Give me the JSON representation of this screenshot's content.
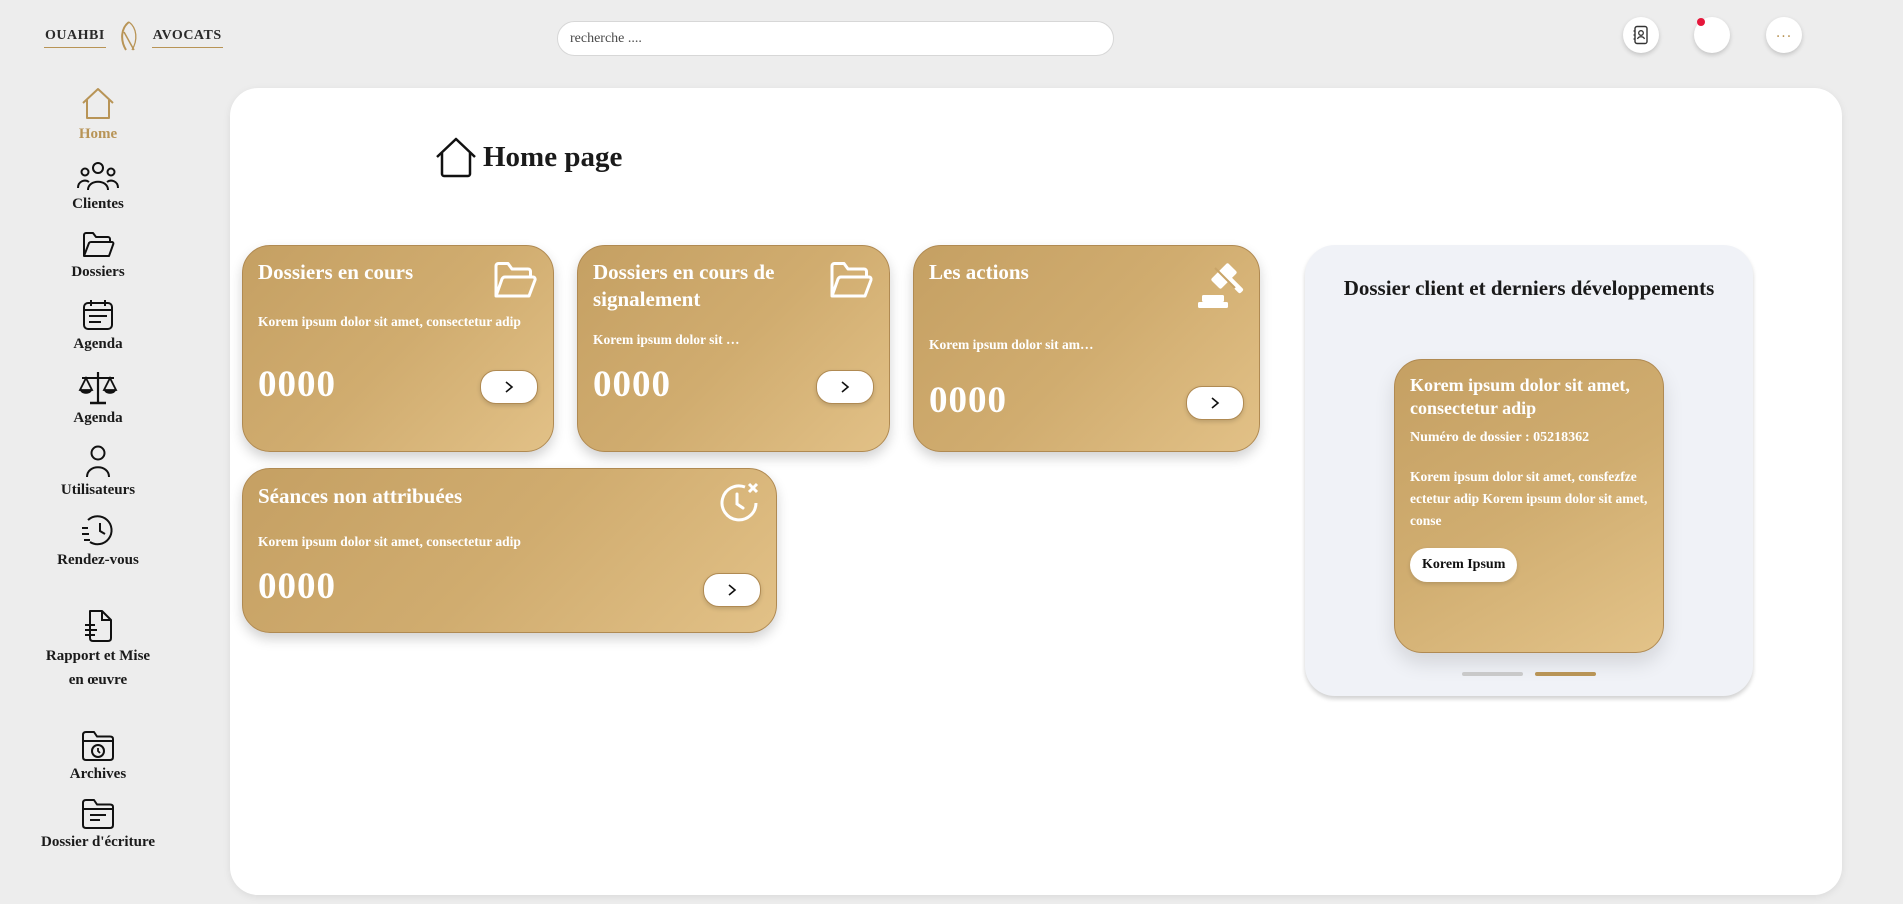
{
  "brand": {
    "left_word": "OUAHBI",
    "right_word": "AVOCATS"
  },
  "search": {
    "placeholder": "recherche ...."
  },
  "topbar": {
    "icons": [
      "contacts-icon",
      "notification-icon",
      "more-icon"
    ],
    "more_label": "..."
  },
  "sidebar": {
    "items": [
      {
        "label": "Home",
        "icon": "home-icon",
        "active": true
      },
      {
        "label": "Clientes",
        "icon": "users-icon"
      },
      {
        "label": "Dossiers",
        "icon": "folder-icon"
      },
      {
        "label": "Agenda",
        "icon": "calendar-icon"
      },
      {
        "label": "Agenda",
        "icon": "scales-icon"
      },
      {
        "label": "Utilisateurs",
        "icon": "user-icon"
      },
      {
        "label": "Rendez-vous",
        "icon": "clock-list-icon"
      },
      {
        "label": "Rapport et Mise en œuvre",
        "icon": "report-icon"
      },
      {
        "label": "Archives",
        "icon": "archive-icon"
      },
      {
        "label": "Dossier d'écriture",
        "icon": "writing-folder-icon"
      }
    ]
  },
  "page": {
    "title": "Home page",
    "icon": "home-icon"
  },
  "cards": [
    {
      "title": "Dossiers en cours",
      "text": "Korem ipsum dolor sit amet, consectetur adip",
      "value": "0000",
      "icon": "folder-icon"
    },
    {
      "title": "Dossiers en cours de signalement",
      "text": "Korem ipsum dolor sit …",
      "value": "0000",
      "icon": "folder-icon"
    },
    {
      "title": "Les actions",
      "text": "Korem ipsum dolor sit am…",
      "value": "0000",
      "icon": "gavel-icon"
    },
    {
      "title": "Séances non attribuées",
      "text": "Korem ipsum dolor sit amet, consectetur adip",
      "value": "0000",
      "icon": "clock-cancel-icon"
    }
  ],
  "widget": {
    "title": "Dossier client et derniers développements",
    "card": {
      "title": "Korem ipsum dolor sit amet, consectetur adip",
      "file_number": "Numéro de dossier : 05218362",
      "description": "Korem ipsum dolor sit amet, consfezfze ectetur adip Korem ipsum dolor sit amet, conse",
      "button": "Korem Ipsum"
    },
    "carousel": {
      "slides": 2,
      "active": 2
    }
  },
  "colors": {
    "gold": "#b89456",
    "gold_light": "#e2c187",
    "background": "#ededed",
    "notification": "#e6173b"
  }
}
